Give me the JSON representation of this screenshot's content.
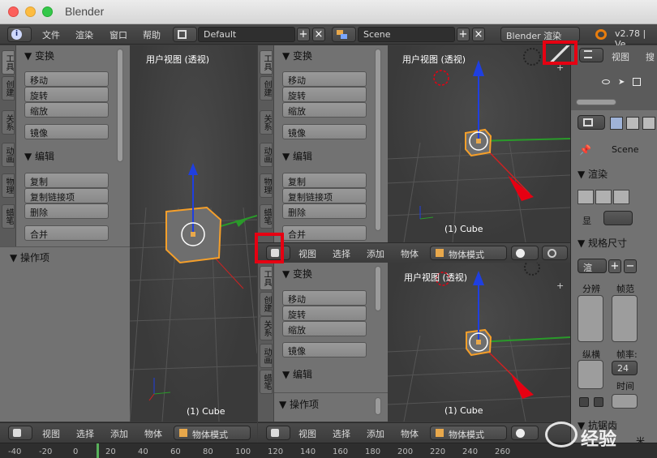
{
  "window": {
    "title": "Blender"
  },
  "infobar": {
    "menus": [
      "文件",
      "渲染",
      "窗口",
      "帮助"
    ],
    "layout": "Default",
    "scene": "Scene",
    "engine": "Blender 渲染",
    "version": "v2.78 | Ve"
  },
  "toolshelf": {
    "tabs": [
      "工具",
      "创建",
      "关系",
      "动画",
      "物理",
      "蜡笔"
    ],
    "transform_header": "▼ 变换",
    "transform_buttons": [
      "移动",
      "旋转",
      "缩放"
    ],
    "mirror_button": "镜像",
    "edit_header": "▼ 编辑",
    "edit_buttons": [
      "复制",
      "复制链接项",
      "删除"
    ],
    "join_button": "合并",
    "operator_header": "▼ 操作项"
  },
  "viewport": {
    "label": "用户视图 (透视)",
    "object_label": "(1) Cube"
  },
  "header3d": {
    "menus": [
      "视图",
      "选择",
      "添加",
      "物体"
    ],
    "mode": "物体模式"
  },
  "properties": {
    "view_menu": "视图",
    "search_menu": "搜",
    "scene_label": "Scene",
    "render_header": "▼ 渲染",
    "display_label": "显",
    "dimensions_header": "▼ 规格尺寸",
    "preset_label": "渲",
    "resolution_label": "分辨",
    "frame_range_label": "帧范",
    "aspect_label": "纵横",
    "frame_rate_label": "帧率:",
    "frame_rate_value": "24",
    "time_label": "时间",
    "antialias_header": "▼ 抗锯齿",
    "bottom_value": "米"
  },
  "timeline": {
    "ticks": [
      "-40",
      "-20",
      "0",
      "20",
      "40",
      "60",
      "80",
      "100",
      "120",
      "140",
      "160",
      "180",
      "200",
      "220",
      "240",
      "260"
    ]
  },
  "watermark": {
    "text": "经验"
  },
  "colors": {
    "highlight": "#e60012",
    "object_outline": "#f59f2a",
    "x_axis": "#cc2222",
    "y_axis": "#2a9a2a",
    "z_axis": "#1f3fe0"
  }
}
